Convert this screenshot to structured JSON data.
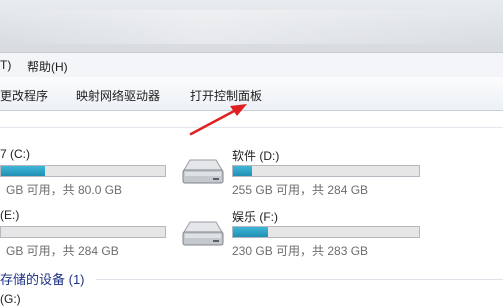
{
  "menubar": {
    "items": [
      {
        "label": "T)"
      },
      {
        "label": "帮助(H)"
      }
    ]
  },
  "toolbar": {
    "items": [
      {
        "label": "更改程序"
      },
      {
        "label": "映射网络驱动器"
      },
      {
        "label": "打开控制面板"
      }
    ]
  },
  "drives": [
    {
      "name": "7 (C:)",
      "space": "GB 可用，共 80.0 GB",
      "used_fraction": 0.27
    },
    {
      "name": "软件 (D:)",
      "space": "255 GB 可用，共 284 GB",
      "used_fraction": 0.1
    },
    {
      "name": "(E:)",
      "space": "GB 可用，共 284 GB",
      "used_fraction": 0.0
    },
    {
      "name": "娱乐 (F:)",
      "space": "230 GB 可用，共 283 GB",
      "used_fraction": 0.19
    }
  ],
  "group": {
    "title": "存储的设备 (1)"
  },
  "cutoff_text": "(G:)",
  "colors": {
    "bar_fill": "#27a2c8",
    "arrow": "#e02020",
    "group_title": "#1e3287"
  }
}
